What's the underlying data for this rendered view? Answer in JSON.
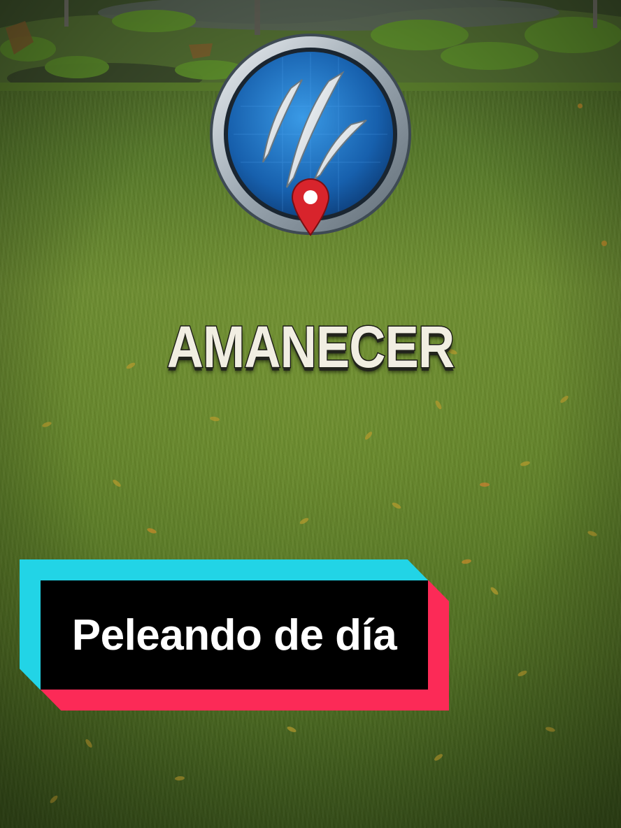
{
  "title": "AMANECER",
  "caption": "Peleando de día",
  "emblem": {
    "icon": "claw-scratch-icon",
    "marker_icon": "map-pin-icon",
    "colors": {
      "glow": "#ffcc33",
      "ring": "#b8c2cc",
      "inner": "#1c6fc0",
      "claw": "#e6ecef",
      "pin": "#d8242c"
    }
  },
  "colors": {
    "caption_cyan": "#22d4e6",
    "caption_pink": "#fc2a57",
    "caption_bg": "#000000",
    "caption_text": "#ffffff",
    "title_text": "#f1eee2",
    "grass": "#5f8029"
  }
}
